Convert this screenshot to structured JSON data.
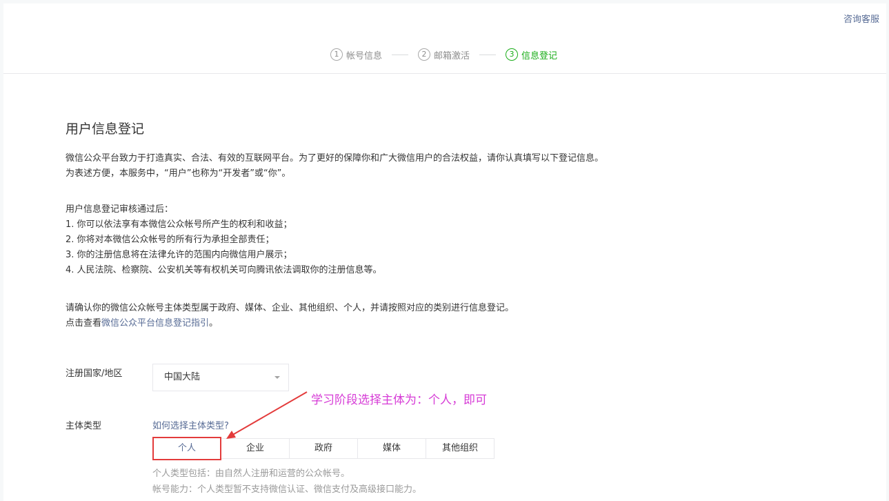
{
  "header": {
    "help_link": "咨询客服",
    "steps": [
      {
        "num": "1",
        "label": "帐号信息"
      },
      {
        "num": "2",
        "label": "邮箱激活"
      },
      {
        "num": "3",
        "label": "信息登记"
      }
    ]
  },
  "main": {
    "title": "用户信息登记",
    "intro": [
      "微信公众平台致力于打造真实、合法、有效的互联网平台。为了更好的保障你和广大微信用户的合法权益，请你认真填写以下登记信息。",
      "为表述方便，本服务中，“用户”也称为“开发者”或“你”。"
    ],
    "rights_heading": "用户信息登记审核通过后：",
    "rights": [
      "1. 你可以依法享有本微信公众帐号所产生的权利和收益；",
      "2. 你将对本微信公众帐号的所有行为承担全部责任；",
      "3. 你的注册信息将在法律允许的范围内向微信用户展示；",
      "4. 人民法院、检察院、公安机关等有权机关可向腾讯依法调取你的注册信息等。"
    ],
    "confirm_text": "请确认你的微信公众帐号主体类型属于政府、媒体、企业、其他组织、个人，并请按照对应的类别进行信息登记。",
    "guide_prefix": "点击查看",
    "guide_link": "微信公众平台信息登记指引",
    "guide_suffix": "。",
    "country_label": "注册国家/地区",
    "country_value": "中国大陆",
    "subject_label": "主体类型",
    "subject_help_link": "如何选择主体类型?",
    "subject_types": [
      "个人",
      "企业",
      "政府",
      "媒体",
      "其他组织"
    ],
    "selected_type": "个人",
    "hint_1": "个人类型包括：由自然人注册和运营的公众帐号。",
    "hint_2": "帐号能力：个人类型暂不支持微信认证、微信支付及高级接口能力。"
  },
  "annotation": {
    "text": "学习阶段选择主体为：个人，即可",
    "color": "#d63bd6",
    "arrow_color": "#e33b3b"
  },
  "colors": {
    "accent_green": "#1aad19",
    "link_blue": "#576b95",
    "highlight_red": "#e33b3b"
  }
}
